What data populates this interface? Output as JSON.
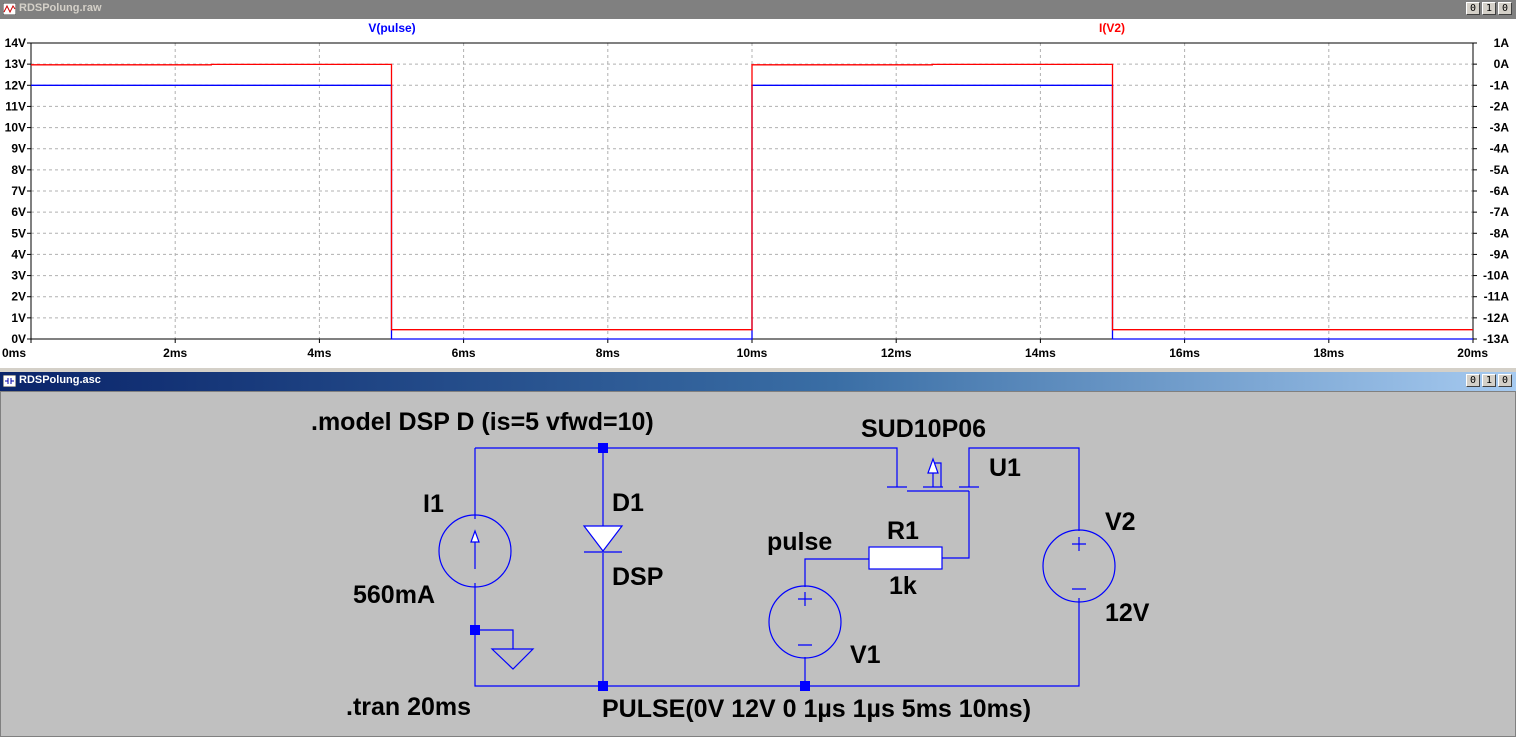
{
  "windows": {
    "waveform": {
      "title": "RDSPolung.raw",
      "buttons": [
        "0",
        "1",
        "0"
      ]
    },
    "schematic": {
      "title": "RDSPolung.asc",
      "buttons": [
        "0",
        "1",
        "0"
      ]
    }
  },
  "chart_data": {
    "type": "line",
    "x_ticks": [
      "0ms",
      "2ms",
      "4ms",
      "6ms",
      "8ms",
      "10ms",
      "12ms",
      "14ms",
      "16ms",
      "18ms",
      "20ms"
    ],
    "y_left_ticks": [
      "0V",
      "1V",
      "2V",
      "3V",
      "4V",
      "5V",
      "6V",
      "7V",
      "8V",
      "9V",
      "10V",
      "11V",
      "12V",
      "13V",
      "14V"
    ],
    "y_right_ticks": [
      "-13A",
      "-12A",
      "-11A",
      "-10A",
      "-9A",
      "-8A",
      "-7A",
      "-6A",
      "-5A",
      "-4A",
      "-3A",
      "-2A",
      "-1A",
      "0A",
      "1A"
    ],
    "xlim": [
      0,
      20
    ],
    "ylim_left": [
      0,
      14
    ],
    "ylim_right": [
      -13,
      1
    ],
    "grid": true,
    "series": [
      {
        "name": "V(pulse)",
        "axis": "left",
        "color": "#0000ff",
        "x": [
          0,
          5,
          5,
          10,
          10,
          15,
          15,
          20
        ],
        "y": [
          12,
          12,
          0,
          0,
          12,
          12,
          0,
          0
        ]
      },
      {
        "name": "I(V2)",
        "axis": "right",
        "color": "#ff0000",
        "x": [
          0,
          2.5,
          2.5,
          5,
          5,
          10,
          10,
          12.5,
          12.5,
          15,
          15,
          20
        ],
        "y": [
          -0.03,
          -0.03,
          -0.01,
          -0.01,
          -12.56,
          -12.56,
          -0.03,
          -0.03,
          -0.01,
          -0.01,
          -12.56,
          -12.56
        ]
      }
    ]
  },
  "schematic": {
    "directive_model": ".model DSP D (is=5 vfwd=10)",
    "directive_tran": ".tran 20ms",
    "mosfet_model": "SUD10P06",
    "mosfet_name": "U1",
    "diode_name": "D1",
    "diode_model": "DSP",
    "current_source_name": "I1",
    "current_source_value": "560mA",
    "resistor_name": "R1",
    "resistor_value": "1k",
    "net_label": "pulse",
    "v1_name": "V1",
    "v1_value": "PULSE(0V 12V 0 1µs 1µs 5ms 10ms)",
    "v2_name": "V2",
    "v2_value": "12V",
    "colors": {
      "wire": "#0000ff",
      "junction": "#0000ff",
      "background": "#c0c0c0"
    }
  }
}
